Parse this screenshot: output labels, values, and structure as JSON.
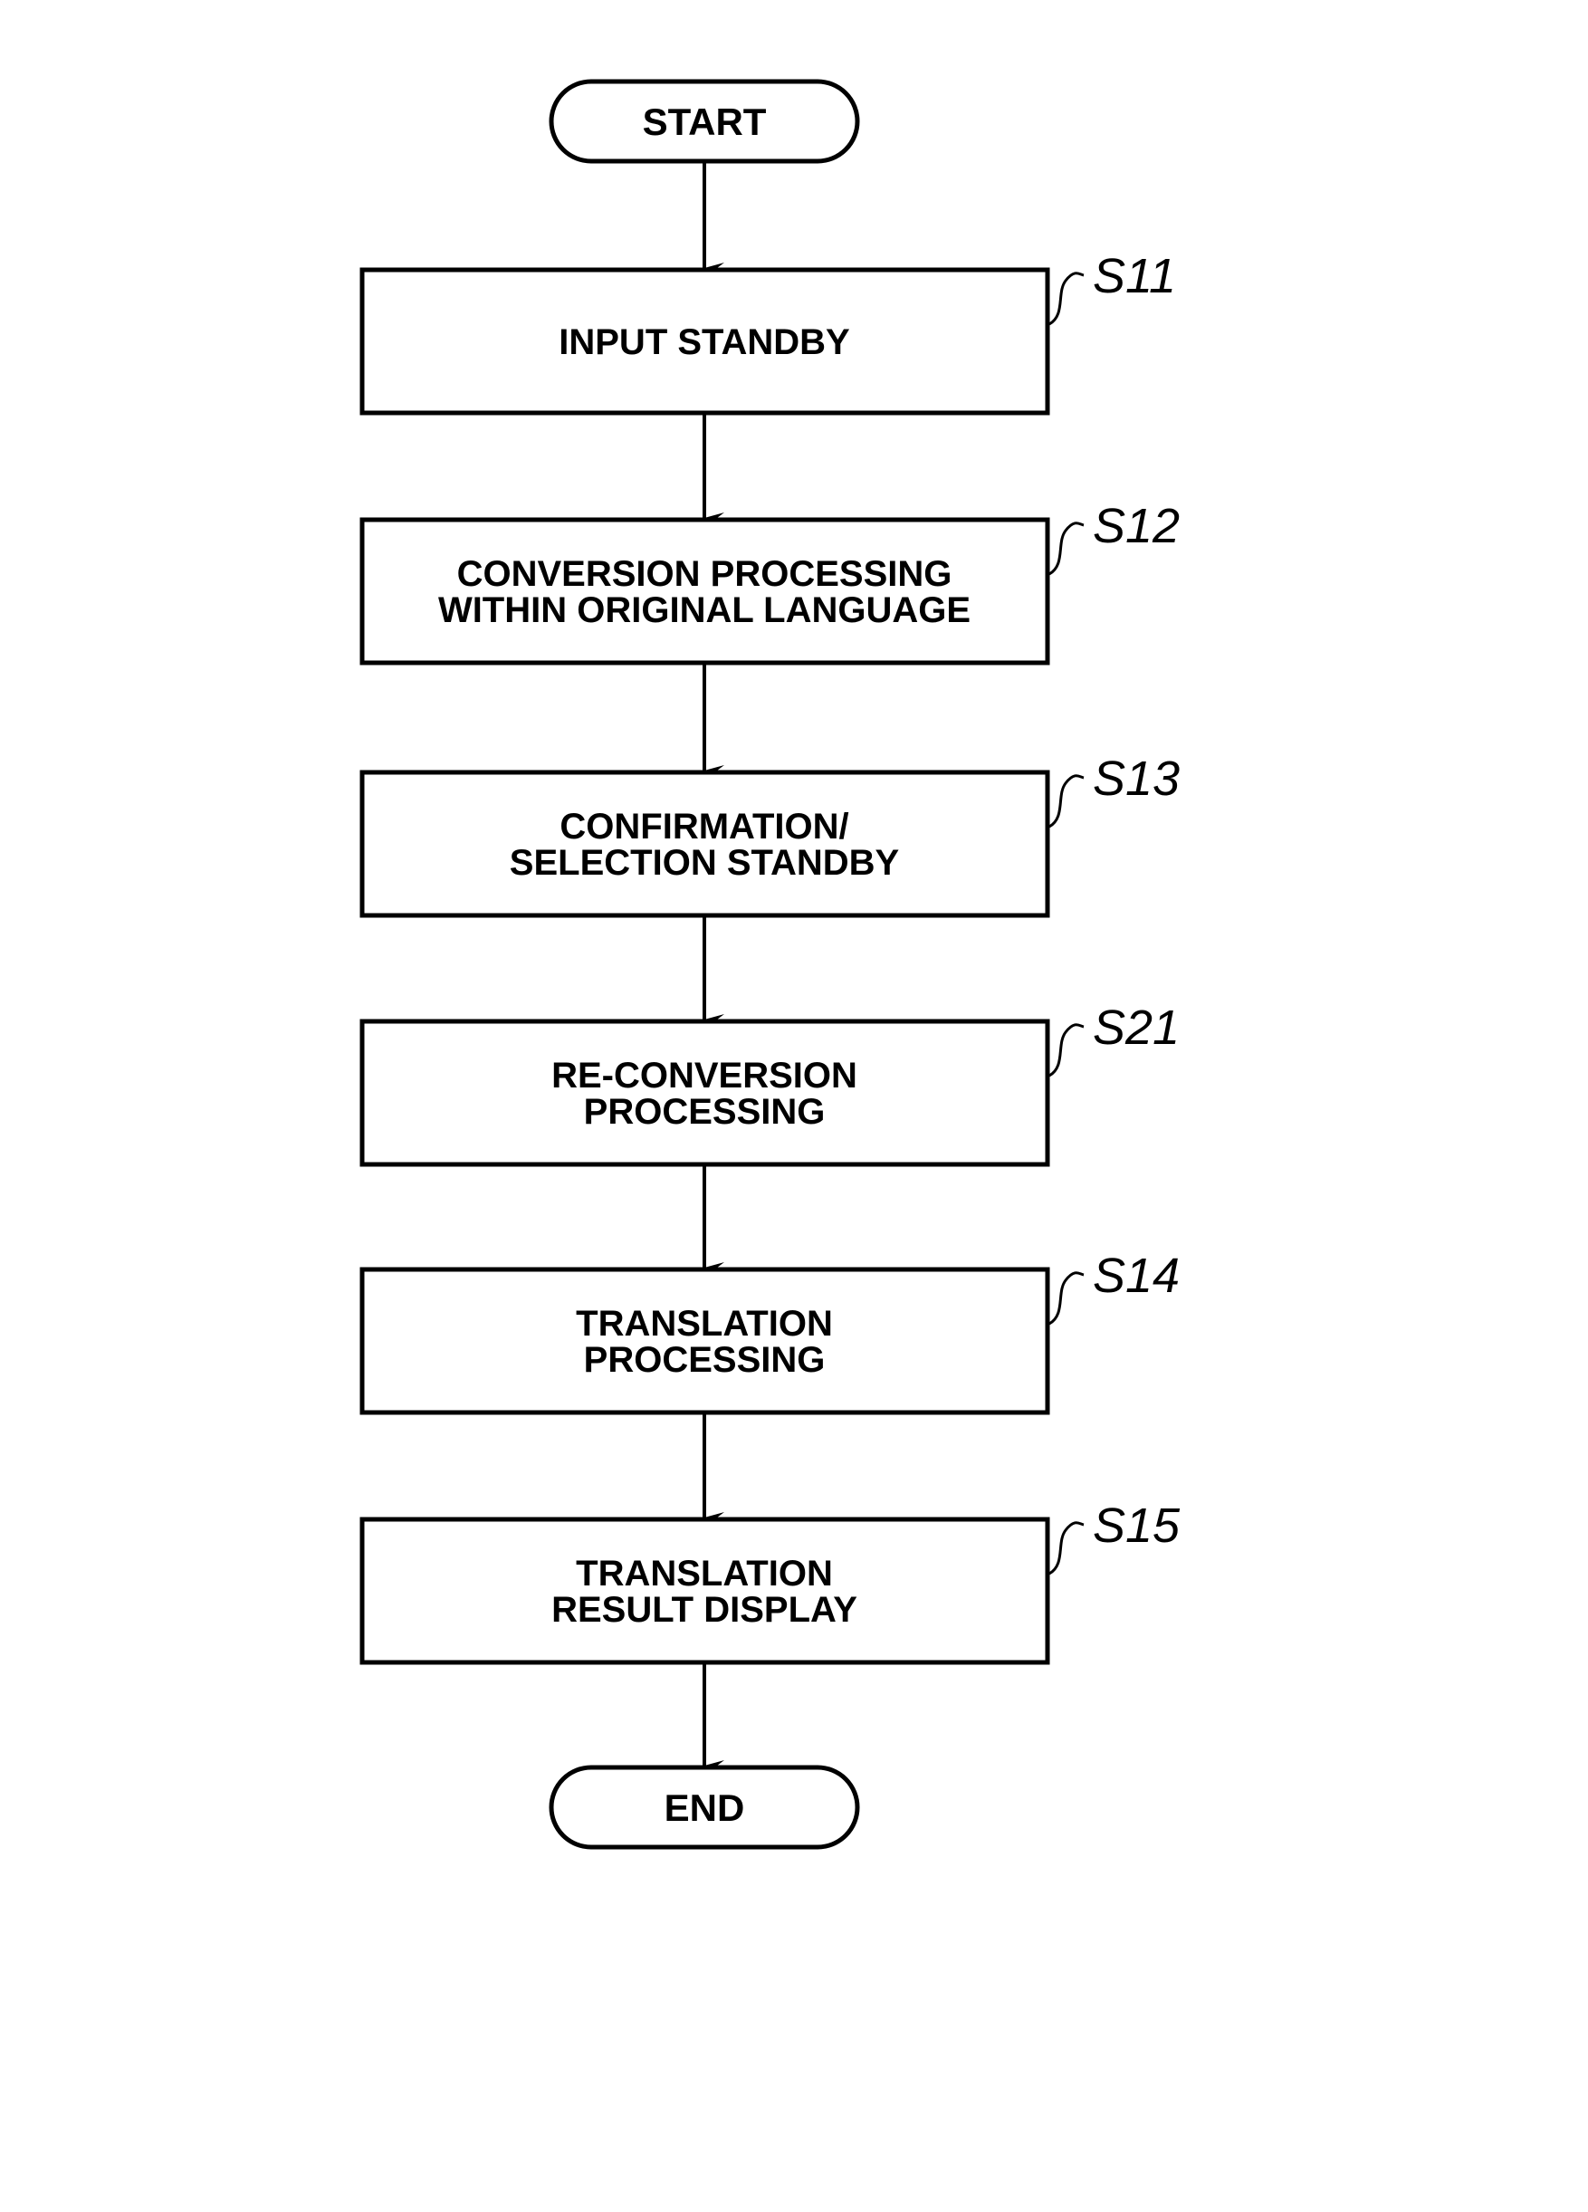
{
  "diagram": {
    "type": "flowchart",
    "direction": "top-to-bottom",
    "start": {
      "label": "START"
    },
    "end": {
      "label": "END"
    },
    "steps": [
      {
        "id": "S11",
        "lines": [
          "INPUT STANDBY"
        ]
      },
      {
        "id": "S12",
        "lines": [
          "CONVERSION PROCESSING",
          "WITHIN ORIGINAL LANGUAGE"
        ]
      },
      {
        "id": "S13",
        "lines": [
          "CONFIRMATION/",
          "SELECTION STANDBY"
        ]
      },
      {
        "id": "S21",
        "lines": [
          "RE-CONVERSION",
          "PROCESSING"
        ]
      },
      {
        "id": "S14",
        "lines": [
          "TRANSLATION",
          "PROCESSING"
        ]
      },
      {
        "id": "S15",
        "lines": [
          "TRANSLATION",
          "RESULT DISPLAY"
        ]
      }
    ],
    "edges": [
      [
        "START",
        "S11"
      ],
      [
        "S11",
        "S12"
      ],
      [
        "S12",
        "S13"
      ],
      [
        "S13",
        "S21"
      ],
      [
        "S21",
        "S14"
      ],
      [
        "S14",
        "S15"
      ],
      [
        "S15",
        "END"
      ]
    ]
  }
}
